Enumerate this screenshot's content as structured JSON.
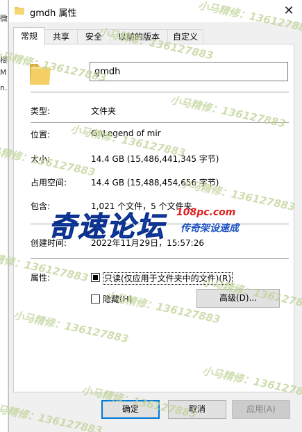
{
  "window": {
    "title": "gmdh 属性",
    "close_glyph": "✕"
  },
  "tabs": [
    {
      "label": "常规",
      "active": true
    },
    {
      "label": "共享",
      "active": false
    },
    {
      "label": "安全",
      "active": false
    },
    {
      "label": "以前的版本",
      "active": false
    },
    {
      "label": "自定义",
      "active": false
    }
  ],
  "general": {
    "name_value": "gmdh",
    "folder_icon": "folder-icon",
    "properties": [
      {
        "label": "类型:",
        "value": "文件夹"
      },
      {
        "label": "位置:",
        "value": "G:\\Legend of mir"
      },
      {
        "label": "大小:",
        "value": "14.4 GB (15,486,441,345 字节)"
      },
      {
        "label": "占用空间:",
        "value": "14.4 GB (15,488,454,656 字节)"
      },
      {
        "label": "包含:",
        "value": "1,021 个文件，5 个文件夹"
      },
      {
        "label": "创建时间:",
        "value": "2022年11月29日，15:57:26"
      }
    ],
    "attributes_label": "属性:",
    "readonly_label": "只读(仅应用于文件夹中的文件)(R)",
    "hidden_label": "隐藏(H)",
    "advanced_button": "高级(D)..."
  },
  "buttons": {
    "ok": "确定",
    "cancel": "取消",
    "apply": "应用(A)"
  },
  "watermark": {
    "text": "小马精修：136127883",
    "logo_text": "奇速论坛",
    "logo_site": "108pc.com",
    "logo_slogan": "传奇架设速成"
  },
  "background_window": {
    "fragments": [
      "微",
      "楼",
      "M",
      "n."
    ]
  },
  "colors": {
    "accent": "#0078d7",
    "folder": "#e8c35a",
    "logo_blue": "#1a4fc4",
    "logo_red": "#e02020"
  }
}
